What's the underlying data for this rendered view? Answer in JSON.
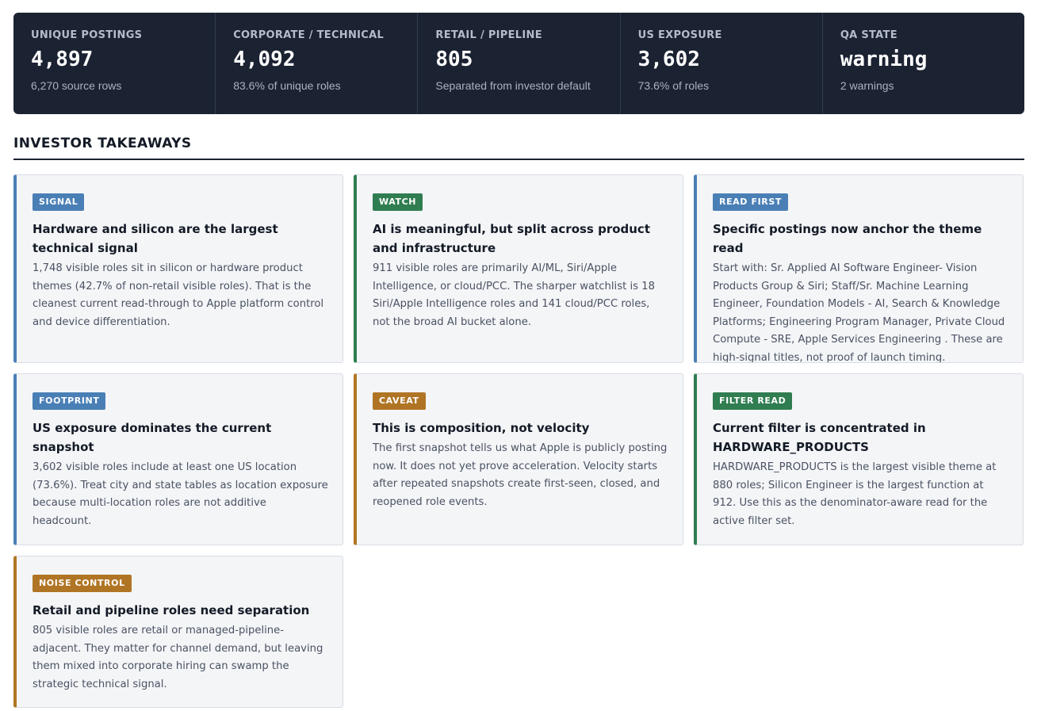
{
  "kpis": [
    {
      "label": "UNIQUE POSTINGS",
      "value": "4,897",
      "sub": "6,270 source rows"
    },
    {
      "label": "CORPORATE / TECHNICAL",
      "value": "4,092",
      "sub": "83.6% of unique roles"
    },
    {
      "label": "RETAIL / PIPELINE",
      "value": "805",
      "sub": "Separated from investor default"
    },
    {
      "label": "US EXPOSURE",
      "value": "3,602",
      "sub": "73.6% of roles"
    },
    {
      "label": "QA STATE",
      "value": "warning",
      "sub": "2 warnings"
    }
  ],
  "section": {
    "title": "INVESTOR TAKEAWAYS"
  },
  "colors": {
    "blue": "#4a7fb6",
    "green": "#2f7d50",
    "amber": "#b07524",
    "header_bg": "#1b2232"
  },
  "cards": [
    {
      "tag": "SIGNAL",
      "tone": "blue",
      "title": "Hardware and silicon are the largest technical signal",
      "body": "1,748 visible roles sit in silicon or hardware product themes (42.7% of non-retail visible roles). That is the cleanest current read-through to Apple platform control and device differentiation."
    },
    {
      "tag": "WATCH",
      "tone": "green",
      "title": "AI is meaningful, but split across product and infrastructure",
      "body": "911 visible roles are primarily AI/ML, Siri/Apple Intelligence, or cloud/PCC. The sharper watchlist is 18 Siri/Apple Intelligence roles and 141 cloud/PCC roles, not the broad AI bucket alone."
    },
    {
      "tag": "READ FIRST",
      "tone": "blue",
      "title": "Specific postings now anchor the theme read",
      "body": "Start with: Sr. Applied AI Software Engineer- Vision Products Group & Siri; Staff/Sr. Machine Learning Engineer, Foundation Models - AI, Search & Knowledge Platforms; Engineering Program Manager, Private Cloud Compute - SRE, Apple Services Engineering . These are high-signal titles, not proof of launch timing."
    },
    {
      "tag": "FOOTPRINT",
      "tone": "blue",
      "title": "US exposure dominates the current snapshot",
      "body": "3,602 visible roles include at least one US location (73.6%). Treat city and state tables as location exposure because multi-location roles are not additive headcount."
    },
    {
      "tag": "CAVEAT",
      "tone": "amber",
      "title": "This is composition, not velocity",
      "body": "The first snapshot tells us what Apple is publicly posting now. It does not yet prove acceleration. Velocity starts after repeated snapshots create first-seen, closed, and reopened role events."
    },
    {
      "tag": "FILTER READ",
      "tone": "green",
      "title": "Current filter is concentrated in HARDWARE_PRODUCTS",
      "body": "HARDWARE_PRODUCTS is the largest visible theme at 880 roles; Silicon Engineer is the largest function at 912. Use this as the denominator-aware read for the active filter set."
    },
    {
      "tag": "NOISE CONTROL",
      "tone": "amber",
      "title": "Retail and pipeline roles need separation",
      "body": "805 visible roles are retail or managed-pipeline-adjacent. They matter for channel demand, but leaving them mixed into corporate hiring can swamp the strategic technical signal."
    }
  ]
}
